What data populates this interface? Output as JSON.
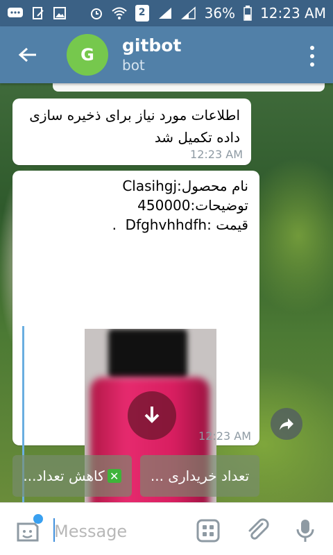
{
  "status_bar": {
    "battery": "36%",
    "time": "12:23 AM",
    "sim_number": "2"
  },
  "header": {
    "avatar_letter": "G",
    "title": "gitbot",
    "subtitle": "bot"
  },
  "messages": [
    {
      "text": "اطلاعات مورد نیاز برای ذخیره سازی داده تکمیل شد",
      "time": "12:23 AM"
    },
    {
      "text": "نام محصول:Clasihgj\nتوضیحات:450000\nقیمت :Dfghvhhdfh  .",
      "time": "12:23 AM"
    }
  ],
  "keyboard_buttons": [
    {
      "label": "کاهش تعداد..."
    },
    {
      "label": "تعداد خریداری ..."
    }
  ],
  "input": {
    "placeholder": "Message"
  },
  "colors": {
    "status_bar": "#3b6185",
    "header": "#5180a8",
    "avatar": "#76c84d",
    "preview_line": "#6aaee0"
  },
  "icons": [
    "back-arrow-icon",
    "more-vert-icon",
    "download-icon",
    "share-icon",
    "sticker-icon",
    "keyboard-icon",
    "attach-icon",
    "mic-icon",
    "cancel-x-icon"
  ]
}
